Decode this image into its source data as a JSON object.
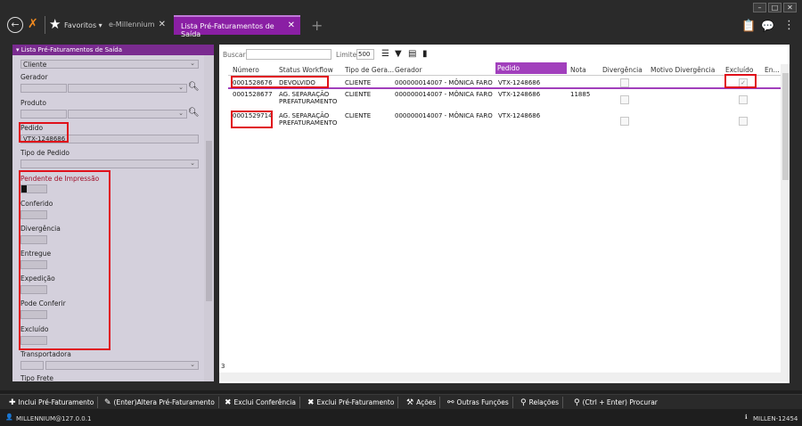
{
  "topbar": {
    "favorites_label": "Favoritos",
    "tab1_label": "e-Millennium",
    "tab2_label": "Lista Pré-Faturamentos de Saída"
  },
  "left": {
    "header": "Lista Pré-Faturamentos de Saída",
    "cliente_value": "Cliente",
    "gerador_label": "Gerador",
    "produto_label": "Produto",
    "pedido_label": "Pedido",
    "pedido_value": "VTX-1248686",
    "tipo_pedido_label": "Tipo de Pedido",
    "pendente_label": "Pendente de Impressão",
    "conferido_label": "Conferido",
    "divergencia_label": "Divergência",
    "entregue_label": "Entregue",
    "expedicao_label": "Expedição",
    "pode_conferir_label": "Pode Conferir",
    "excluido_label": "Excluído",
    "transportadora_label": "Transportadora",
    "tipo_frete_label": "Tipo Frete"
  },
  "toolbar": {
    "buscar_label": "Buscar",
    "limite_label": "Limite",
    "limite_value": "500"
  },
  "grid": {
    "columns": [
      "Número",
      "Status Workflow",
      "Tipo de Gera...",
      "Gerador",
      "Pedido",
      "Nota",
      "Divergência",
      "Motivo Divergência",
      "Excluído",
      "En..."
    ],
    "rows": [
      {
        "numero": "0001528676",
        "status": "DEVOLVIDO",
        "status2": "",
        "tipo": "CLIENTE",
        "gerador": "000000014007 - MÔNICA FARO",
        "pedido": "VTX-1248686",
        "nota": "",
        "excluido_check": "✓"
      },
      {
        "numero": "0001528677",
        "status": "AG. SEPARAÇÃO",
        "status2": "PREFATURAMENTO",
        "tipo": "CLIENTE",
        "gerador": "000000014007 - MÔNICA FARO",
        "pedido": "VTX-1248686",
        "nota": "11885",
        "excluido_check": ""
      },
      {
        "numero": "0001529714",
        "status": "AG. SEPARAÇÃO",
        "status2": "PREFATURAMENTO",
        "tipo": "CLIENTE",
        "gerador": "000000014007 - MÔNICA FARO",
        "pedido": "VTX-1248686",
        "nota": "",
        "excluido_check": ""
      }
    ],
    "count": "3"
  },
  "actions": {
    "inclui": "Inclui Pré-Faturamento",
    "altera": "(Enter)Altera Pré-Faturamento",
    "exclui_conf": "Exclui Conferência",
    "exclui_pre": "Exclui Pré-Faturamento",
    "acoes": "Ações",
    "outras": "Outras Funções",
    "relacoes": "Relações",
    "procurar": "(Ctrl + Enter) Procurar"
  },
  "status": {
    "user": "MILLENNIUM@127.0.0.1",
    "version": "MILLEN-12454"
  },
  "colors": {
    "accent": "#8a1fa4",
    "highlight": "#e0101a"
  }
}
